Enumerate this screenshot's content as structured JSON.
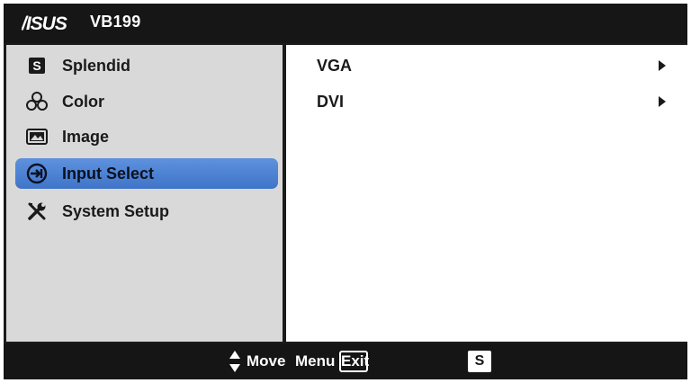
{
  "header": {
    "model": "VB199",
    "logo_text": "/ISUS"
  },
  "menu": {
    "items": [
      {
        "label": "Splendid",
        "icon": "splendid-s-icon"
      },
      {
        "label": "Color",
        "icon": "color-circles-icon"
      },
      {
        "label": "Image",
        "icon": "image-icon"
      },
      {
        "label": "Input Select",
        "icon": "input-select-icon",
        "selected": true
      },
      {
        "label": "System Setup",
        "icon": "wrench-screwdriver-icon"
      }
    ]
  },
  "submenu": {
    "items": [
      {
        "label": "VGA"
      },
      {
        "label": "DVI"
      }
    ]
  },
  "footer": {
    "move_label": "Move",
    "menu_label": "Menu",
    "exit_label": "Exit",
    "splendid_key": "S"
  },
  "colors": {
    "accent": "#4a7fd0",
    "background": "#1b1b1b",
    "left_panel": "#d9d9d9"
  }
}
